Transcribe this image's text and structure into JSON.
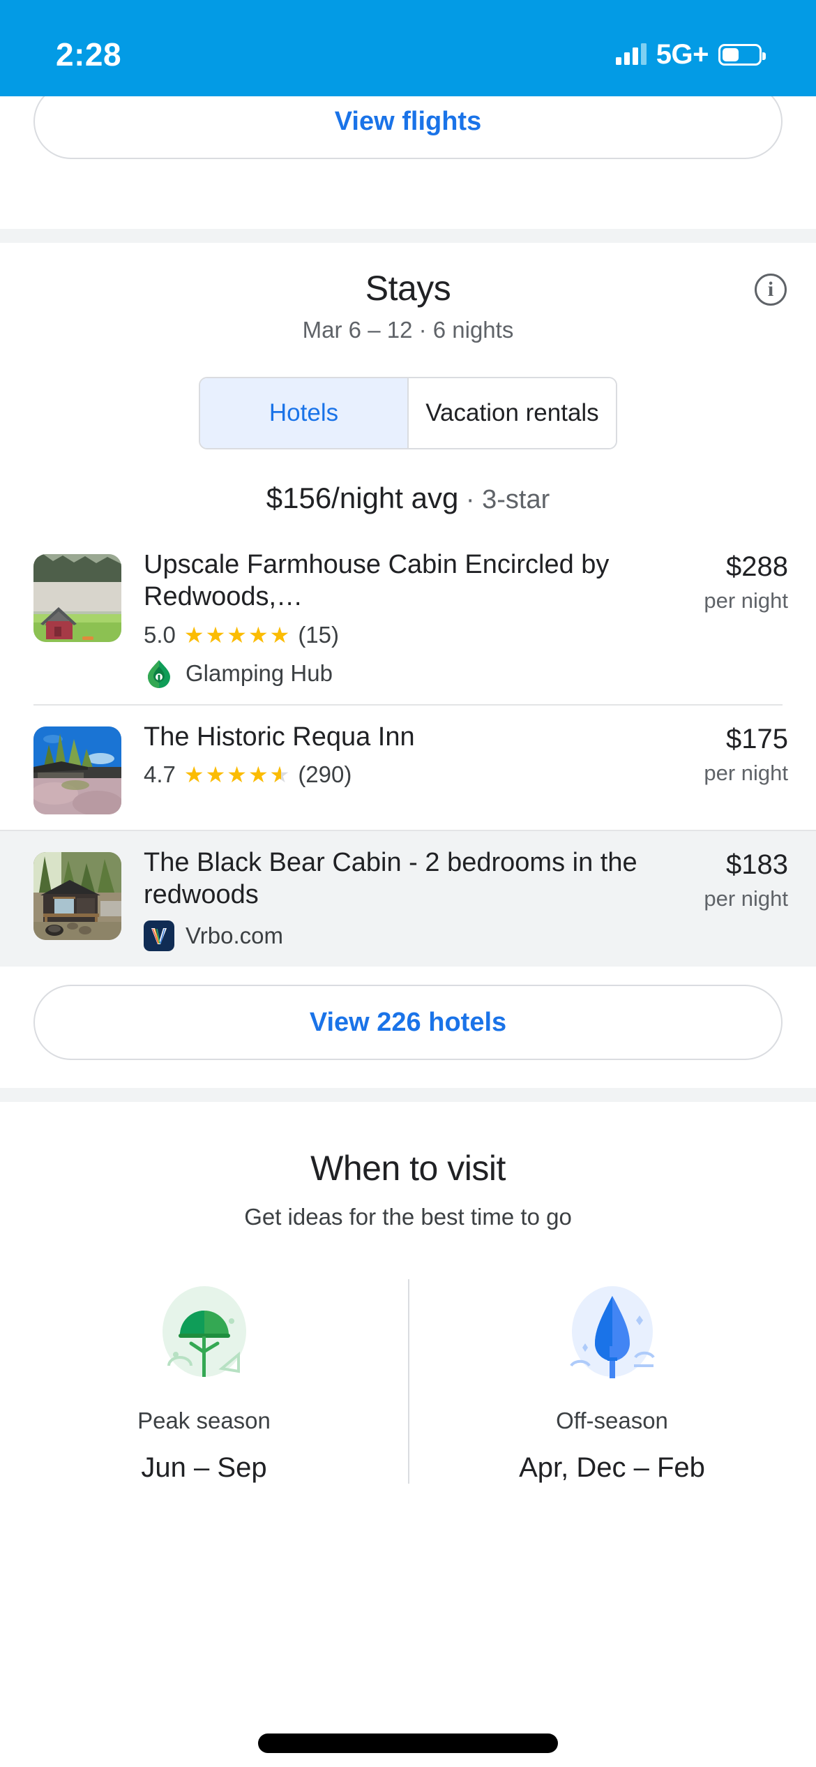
{
  "status_bar": {
    "time": "2:28",
    "network": "5G+",
    "signal_icon": "signal-bars-icon",
    "battery_icon": "battery-icon",
    "background_color": "#039be5"
  },
  "flights": {
    "view_flights_label": "View flights"
  },
  "stays": {
    "title": "Stays",
    "dates": "Mar 6 – 12 · 6 nights",
    "info_icon": "info-icon",
    "info_glyph": "i",
    "tabs": [
      {
        "label": "Hotels",
        "active": true
      },
      {
        "label": "Vacation rentals",
        "active": false
      }
    ],
    "avg_price": "$156/night avg",
    "avg_qualifier": " · 3-star",
    "accent_color": "#1a73e8",
    "listings": [
      {
        "name": "Upscale Farmhouse Cabin Encircled by Redwoods,…",
        "rating": "5.0",
        "stars": 5,
        "review_count": "(15)",
        "provider": "Glamping Hub",
        "provider_logo": "glamping-hub-logo",
        "price": "$288",
        "price_unit": "per night",
        "highlighted": false
      },
      {
        "name": "The Historic Requa Inn",
        "rating": "4.7",
        "stars": 4.5,
        "review_count": "(290)",
        "provider": "",
        "provider_logo": "",
        "price": "$175",
        "price_unit": "per night",
        "highlighted": false
      },
      {
        "name": "The Black Bear Cabin - 2 bedrooms in the redwoods",
        "rating": "",
        "stars": 0,
        "review_count": "",
        "provider": "Vrbo.com",
        "provider_logo": "vrbo-logo",
        "price": "$183",
        "price_unit": "per night",
        "highlighted": true
      }
    ],
    "view_hotels_label": "View 226 hotels"
  },
  "when_to_visit": {
    "title": "When to visit",
    "subtitle": "Get ideas for the best time to go",
    "seasons": [
      {
        "label": "Peak season",
        "months": "Jun – Sep",
        "icon": "tree-icon",
        "color": "#1e8e3e"
      },
      {
        "label": "Off-season",
        "months": "Apr, Dec – Feb",
        "icon": "rain-drop-icon",
        "color": "#1a73e8"
      }
    ]
  }
}
